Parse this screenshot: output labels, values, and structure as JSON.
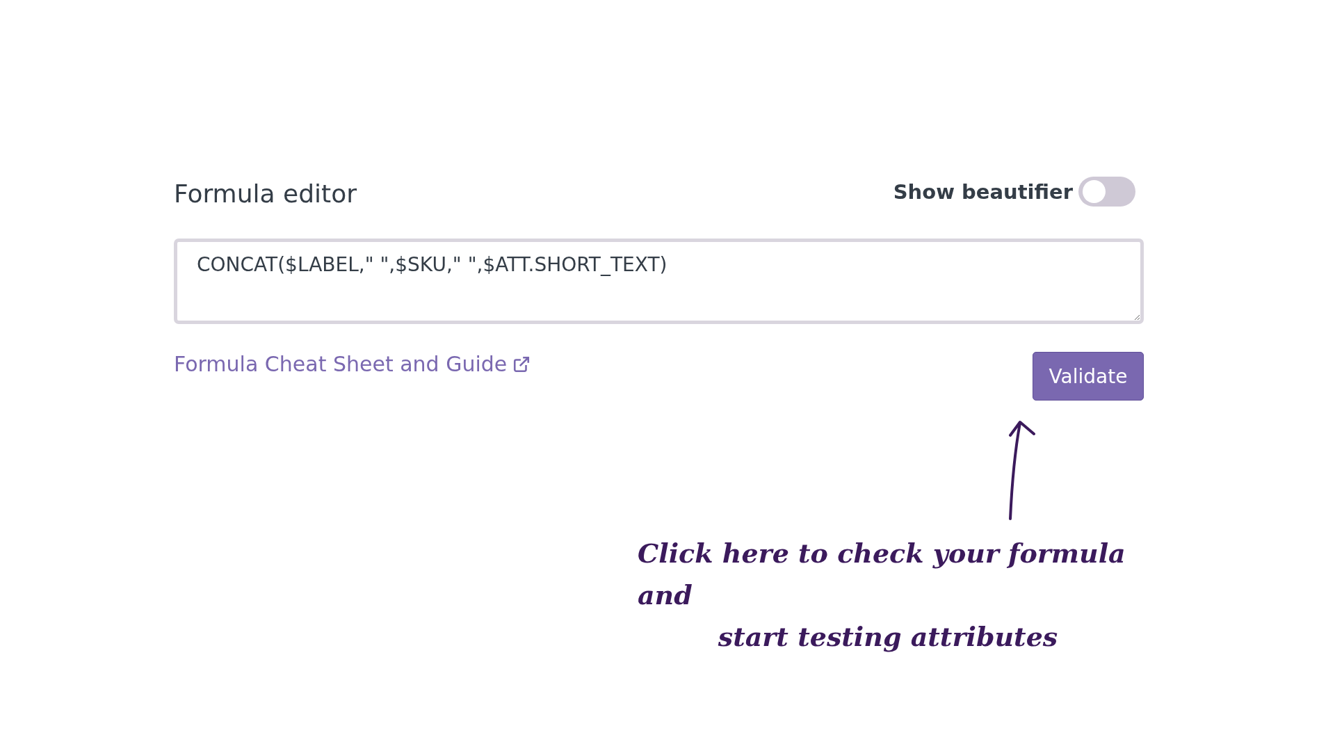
{
  "editor": {
    "title": "Formula editor",
    "beautifier": {
      "label": "Show beautifier",
      "on": false
    },
    "formula": "CONCAT($LABEL,\" \",$SKU,\" \",$ATT.SHORT_TEXT)",
    "guide_link": "Formula Cheat Sheet and Guide",
    "validate_button": "Validate"
  },
  "annotation": {
    "lines": [
      "Click here to check your formula and",
      "start testing attributes"
    ]
  }
}
